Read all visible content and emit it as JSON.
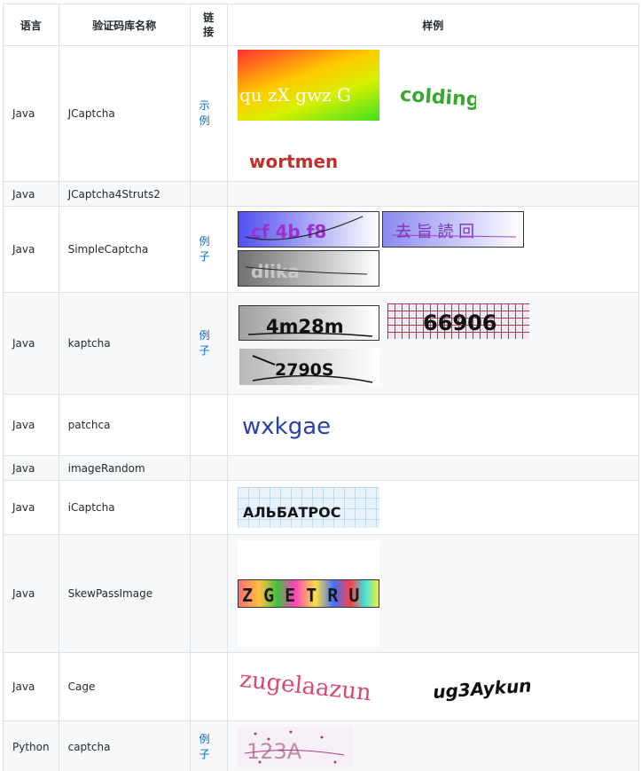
{
  "headers": {
    "lang": "语言",
    "name": "验证码库名称",
    "link": "链接",
    "sample": "样例"
  },
  "rows": [
    {
      "lang": "Java",
      "name": "JCaptcha",
      "link": "示例",
      "captchas": [
        {
          "icon": "gradient-captcha-image",
          "text": "qu zX gwz G"
        },
        {
          "icon": "green-distorted-captcha-image",
          "text": "colding"
        },
        {
          "icon": "red-distorted-captcha-image",
          "text": "wortmen"
        }
      ]
    },
    {
      "lang": "Java",
      "name": "JCaptcha4Struts2",
      "link": "",
      "captchas": []
    },
    {
      "lang": "Java",
      "name": "SimpleCaptcha",
      "link": "例子",
      "captchas": [
        {
          "icon": "purple-gradient-captcha-image",
          "text": "cf 4b f8"
        },
        {
          "icon": "chinese-char-captcha-image",
          "text": "去 旨 読 回"
        },
        {
          "icon": "gray-gradient-captcha-image",
          "text": "dlika"
        }
      ]
    },
    {
      "lang": "Java",
      "name": "kaptcha",
      "link": "例子",
      "captchas": [
        {
          "icon": "kaptcha-captcha-image",
          "text": "4m28m"
        },
        {
          "icon": "grid-captcha-image",
          "text": "66906"
        },
        {
          "icon": "blurred-captcha-image",
          "text": "2790S"
        }
      ]
    },
    {
      "lang": "Java",
      "name": "patchca",
      "link": "",
      "captchas": [
        {
          "icon": "blue-wave-captcha-image",
          "text": "wxkgae"
        }
      ]
    },
    {
      "lang": "Java",
      "name": "imageRandom",
      "link": "",
      "captchas": []
    },
    {
      "lang": "Java",
      "name": "iCaptcha",
      "link": "",
      "captchas": [
        {
          "icon": "cyrillic-captcha-image",
          "text": "АЛЬБАТРОС"
        }
      ]
    },
    {
      "lang": "Java",
      "name": "SkewPassImage",
      "link": "",
      "captchas": [
        {
          "icon": "colorful-blocks-captcha-image",
          "text": "Z G E T R U"
        }
      ]
    },
    {
      "lang": "Java",
      "name": "Cage",
      "link": "",
      "captchas": [
        {
          "icon": "pink-cage-captcha-image",
          "text": "zugelaazun"
        },
        {
          "icon": "black-cage-captcha-image",
          "text": "ug3Aykun"
        }
      ]
    },
    {
      "lang": "Python",
      "name": "captcha",
      "link": "例子",
      "captchas": [
        {
          "icon": "dotted-captcha-image",
          "text": "123A"
        }
      ]
    }
  ],
  "colors": {
    "border": "#dfe2e5",
    "alt_row": "#f6f8fa",
    "link": "#0366d6",
    "text": "#24292e"
  }
}
